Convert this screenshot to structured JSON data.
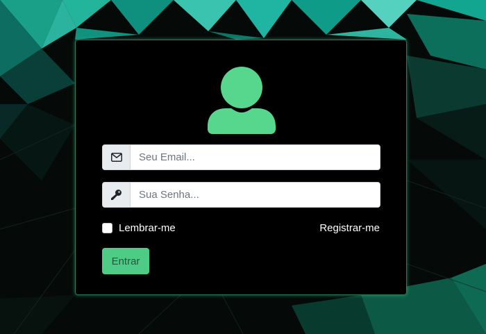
{
  "colors": {
    "accent": "#57d68d",
    "card_background": "#000000",
    "card_border": "#2a7a5c",
    "button_background": "#4ecb85",
    "button_text": "#1e5a3c"
  },
  "login": {
    "avatar_icon": "user-icon",
    "email": {
      "icon": "envelope-icon",
      "placeholder": "Seu Email...",
      "value": ""
    },
    "password": {
      "icon": "key-icon",
      "placeholder": "Sua Senha...",
      "value": ""
    },
    "remember_label": "Lembrar-me",
    "remember_checked": false,
    "register_label": "Registrar-me",
    "submit_label": "Entrar"
  }
}
